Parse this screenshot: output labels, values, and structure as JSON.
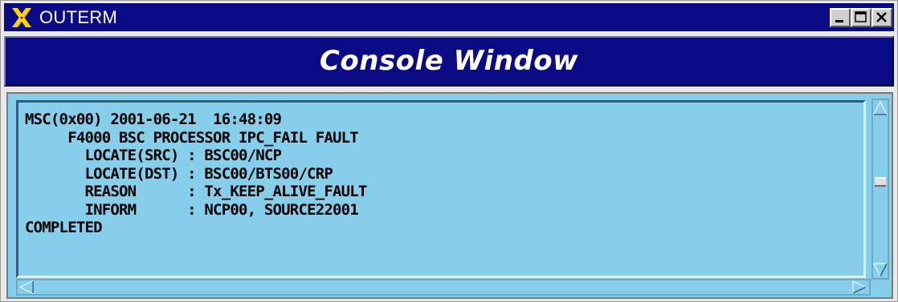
{
  "window": {
    "title": "OUTERM",
    "icon": "x-logo-icon",
    "controls": [
      "minimize-icon",
      "maximize-icon",
      "close-icon"
    ]
  },
  "header": {
    "title": "Console Window"
  },
  "console": {
    "lines": [
      "MSC(0x00) 2001-06-21  16:48:09",
      "     F4000 BSC PROCESSOR IPC_FAIL FAULT",
      "       LOCATE(SRC) : BSC00/NCP",
      "       LOCATE(DST) : BSC00/BTS00/CRP",
      "       REASON      : Tx_KEEP_ALIVE_FAULT",
      "       INFORM      : NCP00, SOURCE22001",
      "COMPLETED"
    ]
  },
  "colors": {
    "titlebar": "#0a0a84",
    "panel_background": "#87ceeb",
    "text": "#000000"
  }
}
